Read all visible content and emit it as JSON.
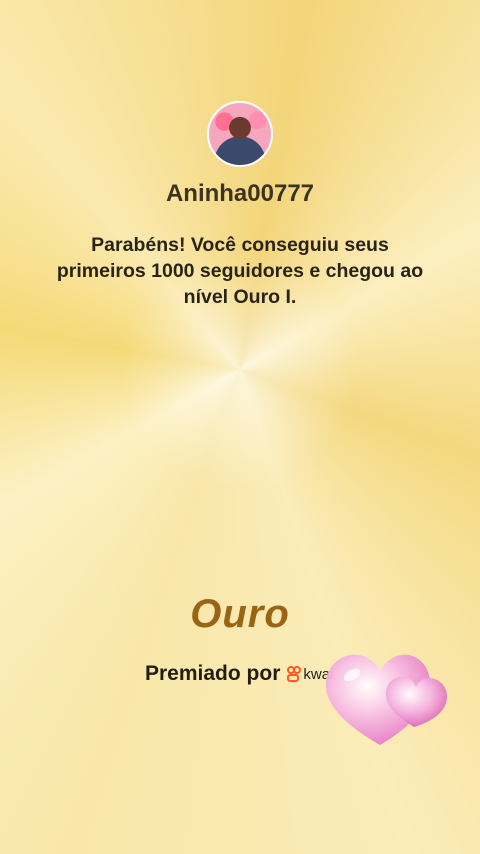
{
  "profile": {
    "username": "Aninha00777"
  },
  "message": "Parabéns! Você conseguiu seus primeiros 1000 seguidores e chegou ao nível Ouro I.",
  "tier_label": "Ouro",
  "award": {
    "label": "Premiado por",
    "brand": "kwai"
  },
  "colors": {
    "tier": "#9a6415",
    "heart": "#f4a6d6",
    "kwai_orange": "#ff5a1f"
  },
  "icons": {
    "hearts": "pink-hearts-icon",
    "kwai": "kwai-logo-icon"
  }
}
